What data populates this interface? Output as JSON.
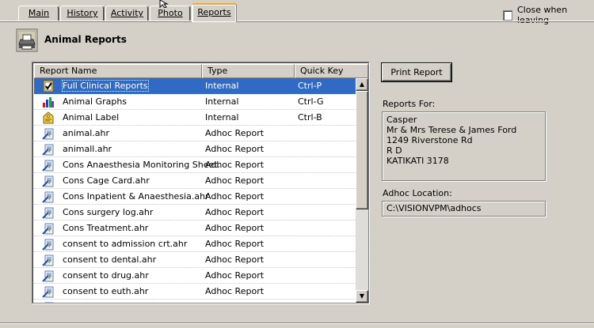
{
  "tabs": [
    {
      "label": "Main",
      "active": false
    },
    {
      "label": "History",
      "active": false
    },
    {
      "label": "Activity",
      "active": false
    },
    {
      "label": "Photo",
      "active": false
    },
    {
      "label": "Reports",
      "active": true
    }
  ],
  "close_when_leaving": {
    "label": "Close when leaving",
    "checked": false
  },
  "header": {
    "title": "Animal Reports",
    "icon": "printer-icon"
  },
  "list": {
    "columns": [
      "Report Name",
      "Type",
      "Quick Key"
    ],
    "rows": [
      {
        "name": "Full Clinical Reports",
        "type": "Internal",
        "key": "Ctrl-P",
        "icon": "clipboard-check-icon",
        "selected": true
      },
      {
        "name": "Animal Graphs",
        "type": "Internal",
        "key": "Ctrl-G",
        "icon": "graph-icon",
        "selected": false
      },
      {
        "name": "Animal Label",
        "type": "Internal",
        "key": "Ctrl-B",
        "icon": "label-icon",
        "selected": false
      },
      {
        "name": "animal.ahr",
        "type": "Adhoc Report",
        "key": "",
        "icon": "report-wand-icon",
        "selected": false
      },
      {
        "name": "animall.ahr",
        "type": "Adhoc Report",
        "key": "",
        "icon": "report-wand-icon",
        "selected": false
      },
      {
        "name": "Cons Anaesthesia Monitoring Sheet.",
        "type": "Adhoc Report",
        "key": "",
        "icon": "report-wand-icon",
        "selected": false
      },
      {
        "name": "Cons Cage Card.ahr",
        "type": "Adhoc Report",
        "key": "",
        "icon": "report-wand-icon",
        "selected": false
      },
      {
        "name": "Cons Inpatient & Anaesthesia.ahr",
        "type": "Adhoc Report",
        "key": "",
        "icon": "report-wand-icon",
        "selected": false
      },
      {
        "name": "Cons surgery log.ahr",
        "type": "Adhoc Report",
        "key": "",
        "icon": "report-wand-icon",
        "selected": false
      },
      {
        "name": "Cons Treatment.ahr",
        "type": "Adhoc Report",
        "key": "",
        "icon": "report-wand-icon",
        "selected": false
      },
      {
        "name": "consent to admission crt.ahr",
        "type": "Adhoc Report",
        "key": "",
        "icon": "report-wand-icon",
        "selected": false
      },
      {
        "name": "consent to dental.ahr",
        "type": "Adhoc Report",
        "key": "",
        "icon": "report-wand-icon",
        "selected": false
      },
      {
        "name": "consent to drug.ahr",
        "type": "Adhoc Report",
        "key": "",
        "icon": "report-wand-icon",
        "selected": false
      },
      {
        "name": "consent to euth.ahr",
        "type": "Adhoc Report",
        "key": "",
        "icon": "report-wand-icon",
        "selected": false
      }
    ]
  },
  "print_button": {
    "label": "Print Report"
  },
  "reports_for": {
    "label": "Reports For:",
    "lines": [
      "Casper",
      "Mr & Mrs Terese & James Ford",
      "1249 Riverstone  Rd",
      "R D",
      "KATIKATI 3178"
    ]
  },
  "adhoc_location": {
    "label": "Adhoc Location:",
    "value": "C:\\VISIONVPM\\adhocs"
  },
  "colors": {
    "selection": "#316ac5",
    "active_tab_accent": "#f0a830",
    "face": "#d4d0c8"
  }
}
